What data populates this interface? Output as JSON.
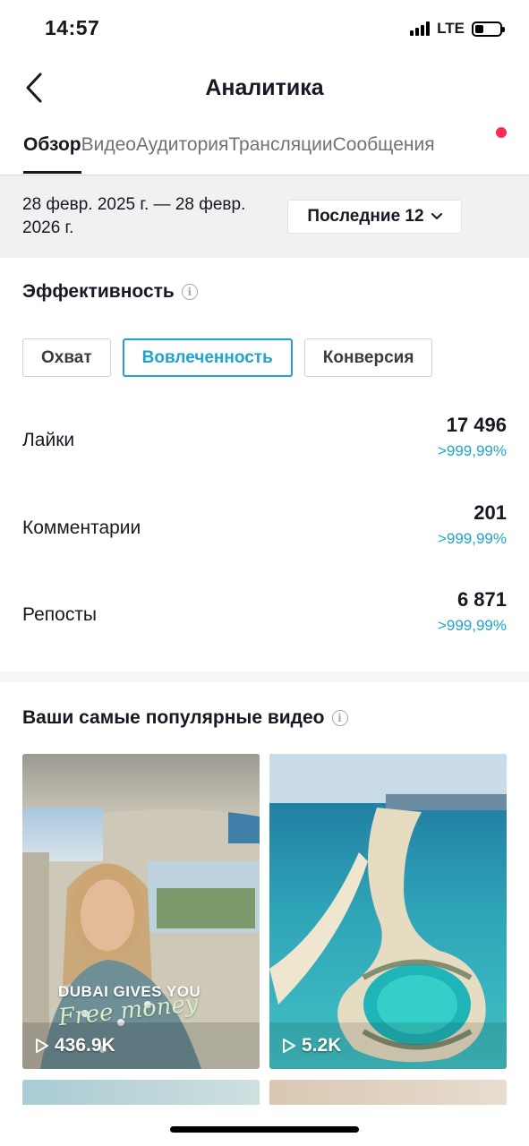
{
  "status_bar": {
    "time": "14:57",
    "network": "LTE",
    "battery_level": 0.35
  },
  "header": {
    "title": "Аналитика",
    "back_icon": "chevron-left-icon"
  },
  "tabs": [
    {
      "label": "Обзор",
      "active": true
    },
    {
      "label": "Видео",
      "active": false
    },
    {
      "label": "Аудитория",
      "active": false
    },
    {
      "label": "Трансляции",
      "active": false
    },
    {
      "label": "Сообщения",
      "active": false
    }
  ],
  "date_bar": {
    "range": "28 февр. 2025 г. — 28 февр. 2026 г.",
    "period_label": "Последние 12"
  },
  "performance": {
    "title": "Эффективность",
    "chips": [
      {
        "label": "Охват",
        "active": false
      },
      {
        "label": "Вовлеченность",
        "active": true
      },
      {
        "label": "Конверсия",
        "active": false
      }
    ],
    "metrics": [
      {
        "label": "Лайки",
        "value": "17 496",
        "change": ">999,99%"
      },
      {
        "label": "Комментарии",
        "value": "201",
        "change": ">999,99%"
      },
      {
        "label": "Репосты",
        "value": "6 871",
        "change": ">999,99%"
      }
    ]
  },
  "popular_videos": {
    "title": "Ваши самые популярные видео",
    "videos": [
      {
        "views": "436.9K",
        "caption_top": "DUBAI GIVES YOU",
        "caption_script": "Free money"
      },
      {
        "views": "5.2K"
      }
    ]
  },
  "colors": {
    "accent": "#20a4c9",
    "notification": "#fe2c55",
    "text": "#161823"
  }
}
